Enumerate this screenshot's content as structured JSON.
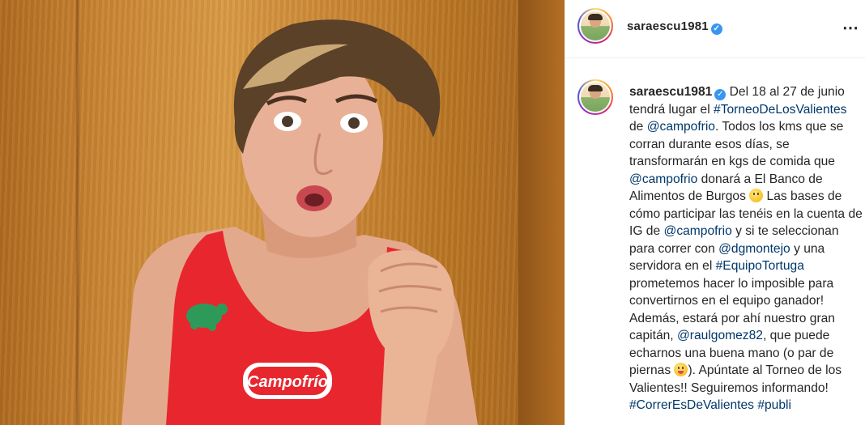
{
  "header": {
    "username": "saraescu1981",
    "verified_icon": "✓",
    "more_label": "⋯"
  },
  "post": {
    "caption_user": "saraescu1981",
    "caption_parts": {
      "p1": " Del 18 al 27 de junio tendrá lugar el ",
      "tag1": "#TorneoDeLosValientes",
      "p2": " de ",
      "tag2": "@campofrio",
      "p3": ". Todos los kms que se corran durante esos días, se transformarán en kgs de comida que ",
      "tag3": "@campofrio",
      "p4": " donará a El Banco de Alimentos de Burgos ",
      "p5": " Las bases de cómo participar las tenéis en la cuenta de IG de ",
      "tag4": "@campofrio",
      "p6": " y si te seleccionan para correr con ",
      "tag5": "@dgmontejo",
      "p7": " y una servidora en el ",
      "tag6": "#EquipoTortuga",
      "p8": " prometemos hacer lo imposible para convertirnos en el equipo ganador! Además, estará por ahí nuestro gran capitán, ",
      "tag7": "@raulgomez82",
      "p9": ", que puede echarnos una buena mano (o par de piernas ",
      "p10": "). Apúntate al Torneo de los Valientes!! Seguiremos informando! ",
      "tag8": "#CorrerEsDeValientes",
      "p11": " ",
      "tag9": "#publi"
    }
  },
  "photo": {
    "jersey_brand": "Campofrío",
    "colors": {
      "jersey": "#e8262e",
      "door": "#c98433",
      "accent_blue": "#3897f0",
      "link": "#00376b"
    }
  }
}
